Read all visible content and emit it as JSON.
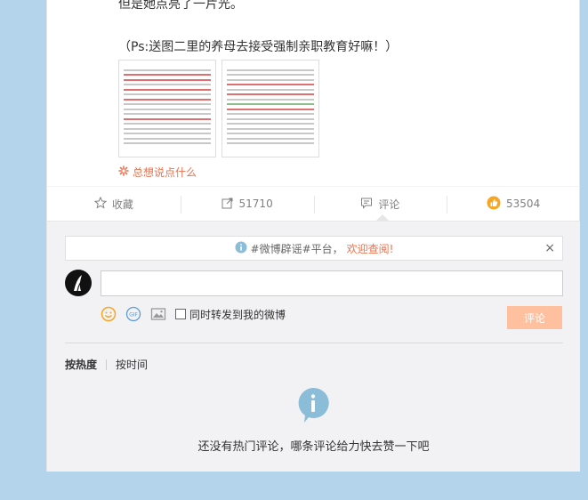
{
  "post": {
    "text_line1": "但是她点亮了一片光。",
    "text_line2": "（Ps:送图二里的养母去接受强制亲职教育好嘛！）",
    "comment_prompt": "总想说点什么"
  },
  "actions": {
    "favorite_label": "收藏",
    "repost_count": "51710",
    "comment_label": "评论",
    "like_count": "53504"
  },
  "comment_panel": {
    "notice_text": "#微博辟谣#平台，",
    "notice_link": "欢迎查阅!",
    "notice_close": "×",
    "repost_checkbox_label": "同时转发到我的微博",
    "submit_label": "评论",
    "sort_hot": "按热度",
    "sort_time": "按时间",
    "empty_message": "还没有热门评论，哪条评论给力快去赞一下吧"
  },
  "icons": {
    "favorite": "star-icon",
    "repost": "repost-icon",
    "comment": "comment-icon",
    "like": "thumbs-up-icon",
    "emoji": "emoji-icon",
    "gif": "gif-icon",
    "image": "image-icon",
    "info": "info-icon"
  },
  "colors": {
    "accent": "#eb7350",
    "submit_disabled": "#ffc09f",
    "background": "#b3d4ea",
    "info_blue": "#8bbcd8"
  }
}
